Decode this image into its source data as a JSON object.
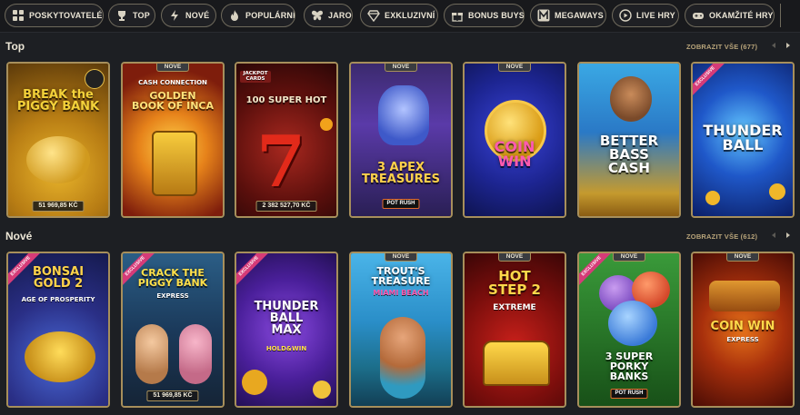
{
  "categories": [
    {
      "label": "POSKYTOVATELÉ",
      "icon": "providers-icon"
    },
    {
      "label": "TOP",
      "icon": "trophy-icon"
    },
    {
      "label": "NOVÉ",
      "icon": "lightning-icon"
    },
    {
      "label": "POPULÁRNÍ",
      "icon": "fire-icon"
    },
    {
      "label": "JARO",
      "icon": "butterfly-icon"
    },
    {
      "label": "EXKLUZIVNÍ",
      "icon": "diamond-icon"
    },
    {
      "label": "BONUS BUYS",
      "icon": "gift-icon"
    },
    {
      "label": "MEGAWAYS",
      "icon": "megaways-icon"
    },
    {
      "label": "LIVE HRY",
      "icon": "play-circle-icon"
    },
    {
      "label": "OKAMŽITÉ HRY",
      "icon": "gamepad-icon"
    }
  ],
  "sections": {
    "top": {
      "title": "Top",
      "view_all": "ZOBRAZIT VŠE (677)",
      "games": [
        {
          "title": "BREAK the\nPIGGY BANK",
          "badge": "",
          "jackpot": "51 969,85 KČ"
        },
        {
          "title": "GOLDEN\nBOOK OF INCA",
          "subtitle": "CASH CONNECTION",
          "badge": "NOVÉ",
          "jackpot": ""
        },
        {
          "title": "100 SUPER HOT",
          "badge": "",
          "jackpot": "2 382 527,70 KČ",
          "subtitle": "JACKPOT CARDS"
        },
        {
          "title": "3 APEX\nTREASURES",
          "badge": "NOVÉ",
          "jackpot": "",
          "pot": "POT RUSH"
        },
        {
          "title": "COIN\nWIN",
          "badge": "NOVÉ",
          "jackpot": ""
        },
        {
          "title": "BETTER\nBASS\nCASH",
          "badge": "",
          "jackpot": ""
        },
        {
          "title": "THUNDER\nBALL",
          "badge": "",
          "jackpot": "",
          "exclusive": "EXCLUSIVE"
        }
      ]
    },
    "new": {
      "title": "Nové",
      "view_all": "ZOBRAZIT VŠE (612)",
      "games": [
        {
          "title": "BONSAI\nGOLD 2",
          "subtitle": "AGE OF PROSPERITY",
          "badge": "",
          "jackpot": "",
          "exclusive": "EXCLUSIVE"
        },
        {
          "title": "CRACK THE\nPIGGY BANK",
          "subtitle": "EXPRESS",
          "badge": "",
          "jackpot": "51 969,85 KČ",
          "exclusive": "EXCLUSIVE"
        },
        {
          "title": "THUNDER\nBALL\nMAX",
          "subtitle": "HOLD&WIN",
          "badge": "",
          "jackpot": "",
          "exclusive": "EXCLUSIVE"
        },
        {
          "title": "TROUT'S\nTREASURE",
          "subtitle": "MIAMI BEACH",
          "badge": "NOVÉ",
          "jackpot": ""
        },
        {
          "title": "HOT\nSTEP 2",
          "subtitle": "EXTREME",
          "badge": "NOVÉ",
          "jackpot": ""
        },
        {
          "title": "3 SUPER\nPORKY\nBANKS",
          "badge": "NOVÉ",
          "jackpot": "",
          "exclusive": "EXCLUSIVE",
          "pot": "POT RUSH"
        },
        {
          "title": "COIN WIN",
          "subtitle": "EXPRESS",
          "badge": "NOVÉ",
          "jackpot": ""
        }
      ]
    }
  },
  "colors": {
    "accent": "#a78f5b",
    "background": "#1d1f23",
    "link": "#b8a47a"
  }
}
